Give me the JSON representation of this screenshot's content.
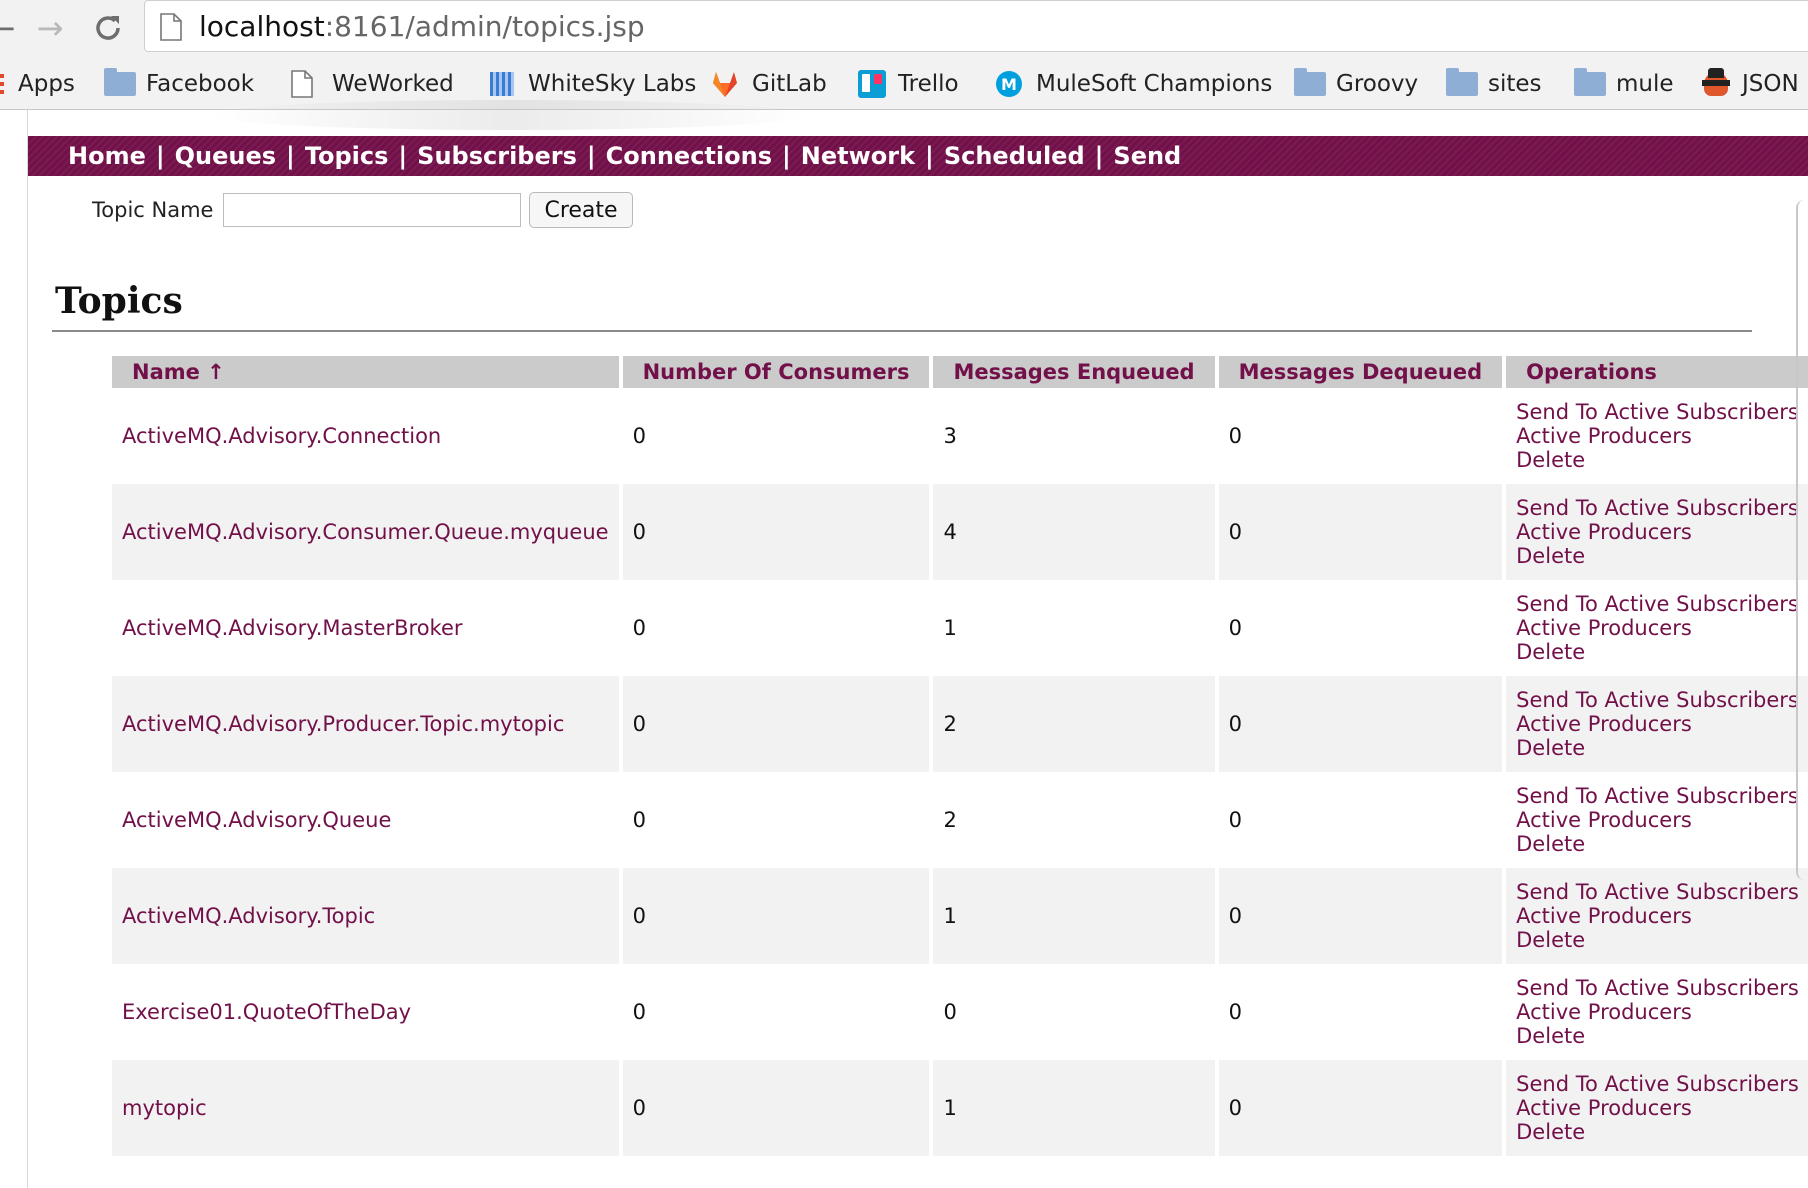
{
  "browser": {
    "url_host": "localhost",
    "url_rest": ":8161/admin/topics.jsp",
    "bookmarks": [
      {
        "label": "Apps",
        "icon": "apps-grid-icon"
      },
      {
        "label": "Facebook",
        "icon": "folder-icon"
      },
      {
        "label": "WeWorked",
        "icon": "page-icon"
      },
      {
        "label": "WhiteSky Labs",
        "icon": "whitesky-icon"
      },
      {
        "label": "GitLab",
        "icon": "gitlab-icon"
      },
      {
        "label": "Trello",
        "icon": "trello-icon"
      },
      {
        "label": "MuleSoft Champions",
        "icon": "mulesoft-icon"
      },
      {
        "label": "Groovy",
        "icon": "folder-icon"
      },
      {
        "label": "sites",
        "icon": "folder-icon"
      },
      {
        "label": "mule",
        "icon": "folder-icon"
      },
      {
        "label": "JSON",
        "icon": "json-icon"
      }
    ]
  },
  "nav": {
    "items": [
      "Home",
      "Queues",
      "Topics",
      "Subscribers",
      "Connections",
      "Network",
      "Scheduled",
      "Send"
    ],
    "separator": "|"
  },
  "form": {
    "label": "Topic Name",
    "value": "",
    "button": "Create"
  },
  "page_title": "Topics",
  "table": {
    "columns": [
      "Name ↑",
      "Number Of Consumers",
      "Messages Enqueued",
      "Messages Dequeued",
      "Operations"
    ],
    "operations": [
      "Send To Active Subscribers",
      "Active Producers",
      "Delete"
    ],
    "rows": [
      {
        "name": "ActiveMQ.Advisory.Connection",
        "consumers": "0",
        "enqueued": "3",
        "dequeued": "0"
      },
      {
        "name": "ActiveMQ.Advisory.Consumer.Queue.myqueue",
        "consumers": "0",
        "enqueued": "4",
        "dequeued": "0"
      },
      {
        "name": "ActiveMQ.Advisory.MasterBroker",
        "consumers": "0",
        "enqueued": "1",
        "dequeued": "0"
      },
      {
        "name": "ActiveMQ.Advisory.Producer.Topic.mytopic",
        "consumers": "0",
        "enqueued": "2",
        "dequeued": "0"
      },
      {
        "name": "ActiveMQ.Advisory.Queue",
        "consumers": "0",
        "enqueued": "2",
        "dequeued": "0"
      },
      {
        "name": "ActiveMQ.Advisory.Topic",
        "consumers": "0",
        "enqueued": "1",
        "dequeued": "0"
      },
      {
        "name": "Exercise01.QuoteOfTheDay",
        "consumers": "0",
        "enqueued": "0",
        "dequeued": "0"
      },
      {
        "name": "mytopic",
        "consumers": "0",
        "enqueued": "1",
        "dequeued": "0"
      }
    ]
  },
  "colors": {
    "brand": "#721049",
    "header_bg": "#cbcbcb",
    "row_alt": "#f2f2f2"
  }
}
